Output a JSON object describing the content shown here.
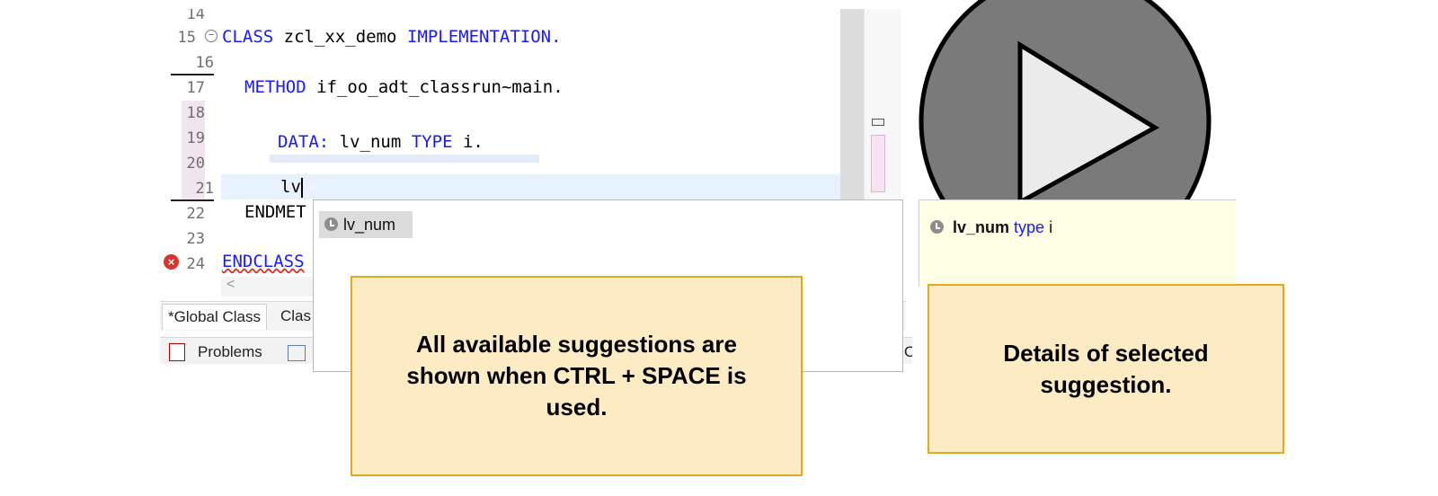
{
  "editor": {
    "line_numbers": [
      "14",
      "15",
      "16",
      "17",
      "18",
      "19",
      "20",
      "21",
      "22",
      "23",
      "24"
    ],
    "code_lines": {
      "l15_kw1": "CLASS",
      "l15_name": "zcl_xx_demo",
      "l15_kw2": "IMPLEMENTATION.",
      "l17_kw": "METHOD",
      "l17_rest": "if_oo_adt_classrun~main.",
      "l19_kw": "DATA:",
      "l19_var": "lv_num",
      "l19_kw2": "TYPE",
      "l19_rest": "i.",
      "l21_typed": "lv",
      "l22_text": "ENDMET",
      "l24_text": "ENDCLASS"
    },
    "scroll_left_arrow": "<",
    "tabs": [
      "*Global Class",
      "Clas"
    ],
    "bottom_tabs": [
      "Problems"
    ],
    "right_stub": "O"
  },
  "completion_popup": {
    "items": [
      "lv_num"
    ]
  },
  "details_panel": {
    "name": "lv_num",
    "keyword": "type",
    "type": "i"
  },
  "callouts": {
    "suggestions": "All available suggestions are shown when CTRL + SPACE is used.",
    "details": "Details of selected suggestion."
  },
  "colors": {
    "keyword": "#1a1aff",
    "callout_fill": "#fdebc3",
    "callout_border": "#e3a820",
    "details_fill": "#ffffe6",
    "play_fill": "#7a7a7a"
  },
  "icons": [
    "collapse-icon",
    "error-icon",
    "clock-icon",
    "play-icon",
    "problems-icon"
  ]
}
